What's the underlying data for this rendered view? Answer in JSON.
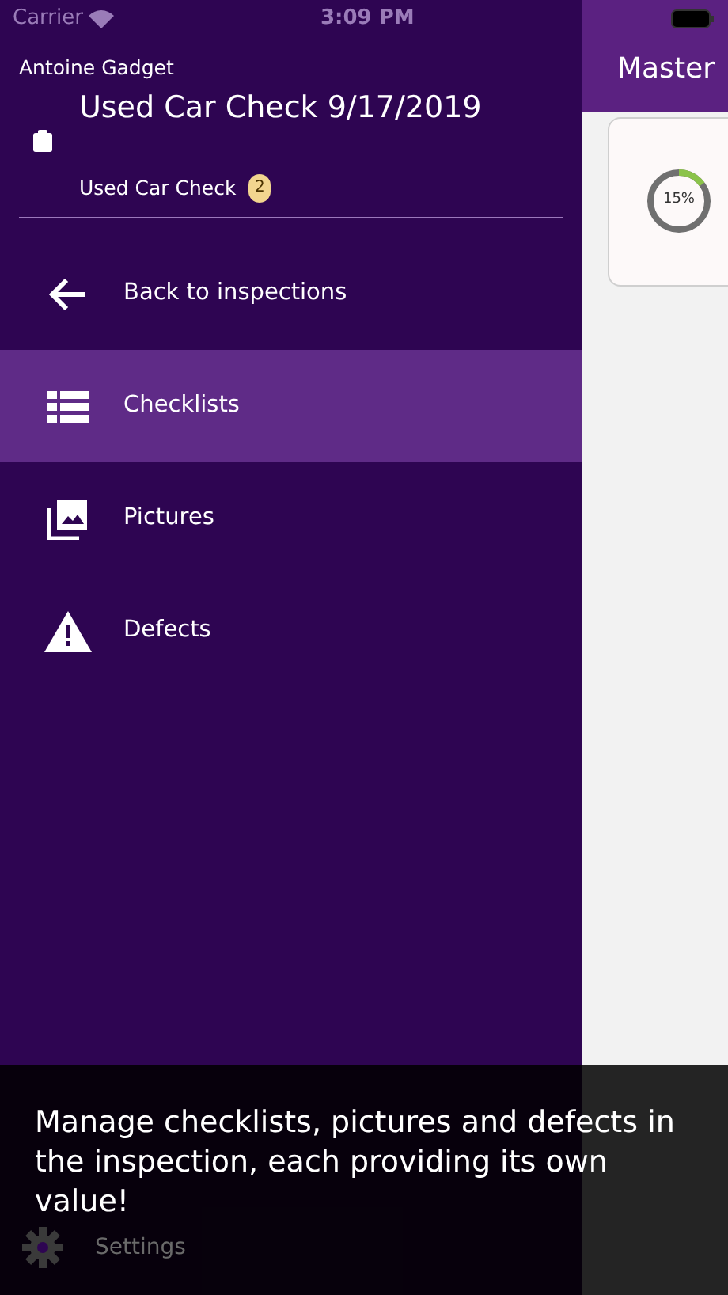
{
  "status_bar": {
    "carrier": "Carrier",
    "time": "3:09 PM"
  },
  "drawer": {
    "user": "Antoine Gadget",
    "title": "Used Car Check 9/17/2019",
    "subtitle": "Used Car Check",
    "badge": "2",
    "items": [
      {
        "kind": "back",
        "label": "Back to inspections",
        "selected": false
      },
      {
        "kind": "list",
        "label": "Checklists",
        "selected": true
      },
      {
        "kind": "pictures",
        "label": "Pictures",
        "selected": false
      },
      {
        "kind": "warning",
        "label": "Defects",
        "selected": false
      }
    ],
    "settings": "Settings"
  },
  "master": {
    "title": "Master",
    "progress": {
      "reading": "15%",
      "level": 0.15
    }
  },
  "tooltip": "Manage checklists, pictures and defects in the inspection, each providing its own value!"
}
